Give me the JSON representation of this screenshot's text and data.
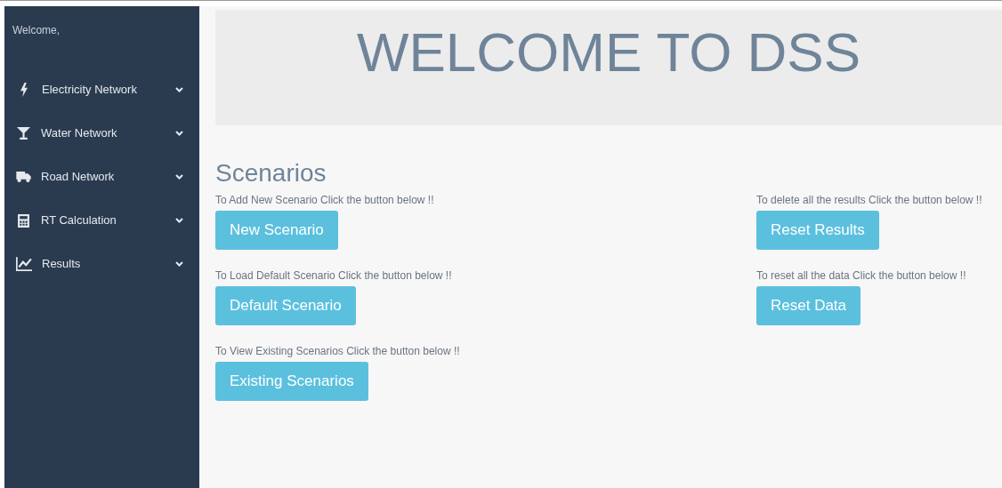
{
  "sidebar": {
    "welcome": "Welcome,",
    "items": [
      {
        "label": "Electricity Network"
      },
      {
        "label": "Water Network"
      },
      {
        "label": "Road Network"
      },
      {
        "label": "RT Calculation"
      },
      {
        "label": "Results"
      }
    ]
  },
  "header": {
    "title": "WELCOME TO DSS"
  },
  "scenarios": {
    "heading": "Scenarios",
    "left": [
      {
        "caption": "To Add New Scenario Click the button below !!",
        "button": "New Scenario"
      },
      {
        "caption": "To Load Default Scenario Click the button below !!",
        "button": "Default Scenario"
      },
      {
        "caption": "To View Existing Scenarios Click the button below !!",
        "button": "Existing Scenarios"
      }
    ],
    "right": [
      {
        "caption": "To delete all the results Click the button below !!",
        "button": "Reset Results"
      },
      {
        "caption": "To reset all the data Click the button below !!",
        "button": "Reset Data"
      }
    ]
  }
}
